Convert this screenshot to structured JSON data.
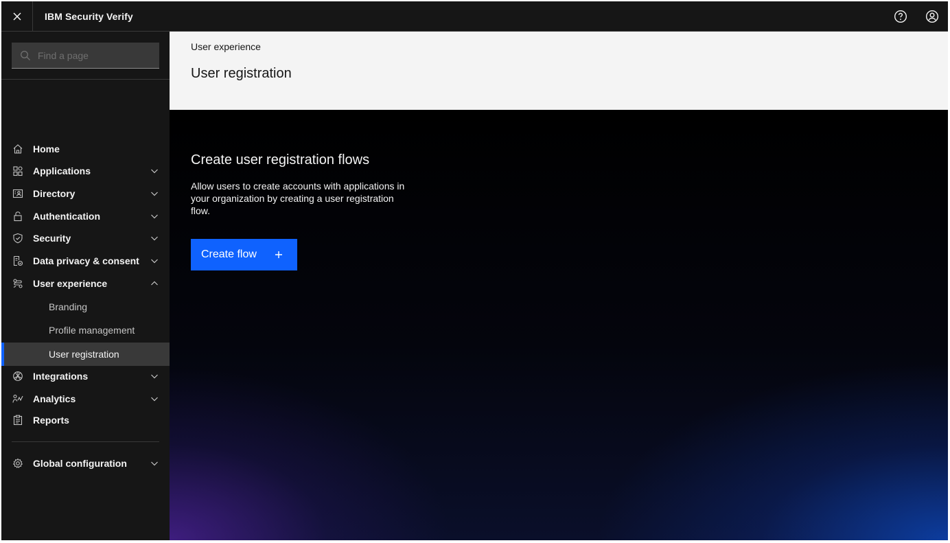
{
  "header": {
    "app_name": "IBM Security Verify",
    "close_label": "Close menu",
    "help_label": "Help",
    "user_label": "User profile"
  },
  "sidebar": {
    "search_placeholder": "Find a page",
    "items": [
      {
        "label": "Home",
        "icon": "home-icon"
      },
      {
        "label": "Applications",
        "icon": "applications-icon",
        "expandable": true
      },
      {
        "label": "Directory",
        "icon": "directory-icon",
        "expandable": true
      },
      {
        "label": "Authentication",
        "icon": "lock-icon",
        "expandable": true
      },
      {
        "label": "Security",
        "icon": "shield-icon",
        "expandable": true
      },
      {
        "label": "Data privacy & consent",
        "icon": "data-privacy-icon",
        "expandable": true
      },
      {
        "label": "User experience",
        "icon": "user-experience-icon",
        "expandable": true,
        "expanded": true,
        "children": [
          {
            "label": "Branding"
          },
          {
            "label": "Profile management"
          },
          {
            "label": "User registration",
            "active": true
          }
        ]
      },
      {
        "label": "Integrations",
        "icon": "integrations-icon",
        "expandable": true
      },
      {
        "label": "Analytics",
        "icon": "analytics-icon",
        "expandable": true
      },
      {
        "label": "Reports",
        "icon": "reports-icon"
      },
      {
        "label": "Global configuration",
        "icon": "gear-icon",
        "expandable": true
      }
    ]
  },
  "main": {
    "breadcrumb": "User experience",
    "title": "User registration",
    "hero": {
      "title": "Create user registration flows",
      "description": "Allow users to create accounts with applications in your organization by creating a user registration flow.",
      "button_label": "Create flow"
    }
  },
  "colors": {
    "accent": "#0f62fe",
    "sidebar_bg": "#161616",
    "header_bg": "#f4f4f4"
  }
}
